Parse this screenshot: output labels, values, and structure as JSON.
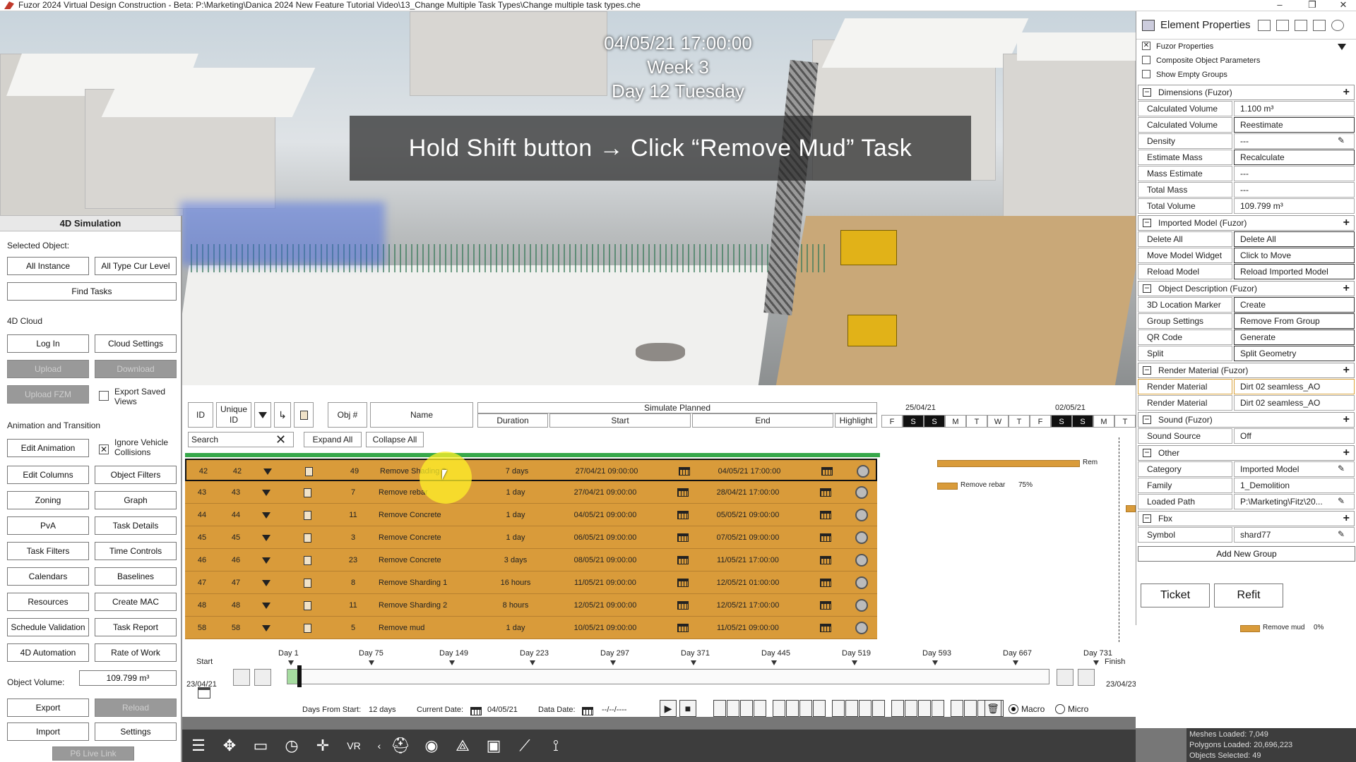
{
  "window": {
    "title": "Fuzor 2024 Virtual Design Construction - Beta: P:\\Marketing\\Danica 2024 New Feature Tutorial Video\\13_Change Multiple Task Types\\Change multiple task types.che",
    "minimize": "–",
    "restore": "❐",
    "close": "✕"
  },
  "viewport": {
    "datetime": "04/05/21 17:00:00",
    "week": "Week 3",
    "day": "Day 12 Tuesday",
    "caption": "Hold Shift button  → Click “Remove Mud” Task"
  },
  "left_panel": {
    "title": "4D Simulation",
    "selected_object_label": "Selected Object:",
    "all_instance": "All Instance",
    "all_type_cur_level": "All Type Cur Level",
    "find_tasks": "Find Tasks",
    "cloud_label": "4D Cloud",
    "log_in": "Log In",
    "cloud_settings": "Cloud Settings",
    "upload": "Upload",
    "download": "Download",
    "upload_fzm": "Upload FZM",
    "export_saved_views": "Export Saved Views",
    "animation_label": "Animation and Transition",
    "edit_animation": "Edit Animation",
    "ignore_vehicle_collisions": "Ignore Vehicle Collisions",
    "ignore_vehicle_checked": "✕",
    "buttons": [
      "Edit Columns",
      "Object Filters",
      "Zoning",
      "Graph",
      "PvA",
      "Task Details",
      "Task Filters",
      "Time Controls",
      "Calendars",
      "Baselines",
      "Resources",
      "Create MAC",
      "Schedule Validation",
      "Task Report",
      "4D Automation",
      "Rate of Work"
    ],
    "object_volume_label": "Object Volume:",
    "object_volume": "109.799 m³",
    "export": "Export",
    "reload": "Reload",
    "import": "Import",
    "settings": "Settings",
    "p6_live_link": "P6 Live Link"
  },
  "table": {
    "headers": {
      "id": "ID",
      "unique_id": "Unique ID",
      "obj": "Obj #",
      "name": "Name",
      "simulate": "Simulate Planned",
      "duration": "Duration",
      "start": "Start",
      "end": "End",
      "highlight": "Highlight"
    },
    "search_placeholder": "Search",
    "search_value": "Search",
    "expand_all": "Expand All",
    "collapse_all": "Collapse All",
    "rows": [
      {
        "id": "42",
        "uid": "42",
        "obj": "49",
        "name": "Remove Shading 3",
        "duration": "7 days",
        "start": "27/04/21 09:00:00",
        "end": "04/05/21 17:00:00"
      },
      {
        "id": "43",
        "uid": "43",
        "obj": "7",
        "name": "Remove rebar",
        "duration": "1 day",
        "start": "27/04/21 09:00:00",
        "end": "28/04/21 17:00:00"
      },
      {
        "id": "44",
        "uid": "44",
        "obj": "11",
        "name": "Remove Concrete",
        "duration": "1 day",
        "start": "04/05/21 09:00:00",
        "end": "05/05/21 09:00:00"
      },
      {
        "id": "45",
        "uid": "45",
        "obj": "3",
        "name": "Remove Concrete",
        "duration": "1 day",
        "start": "06/05/21 09:00:00",
        "end": "07/05/21 09:00:00"
      },
      {
        "id": "46",
        "uid": "46",
        "obj": "23",
        "name": "Remove Concrete",
        "duration": "3 days",
        "start": "08/05/21 09:00:00",
        "end": "11/05/21 17:00:00"
      },
      {
        "id": "47",
        "uid": "47",
        "obj": "8",
        "name": "Remove Sharding 1",
        "duration": "16 hours",
        "start": "11/05/21 09:00:00",
        "end": "12/05/21 01:00:00"
      },
      {
        "id": "48",
        "uid": "48",
        "obj": "11",
        "name": "Remove Sharding 2",
        "duration": "8 hours",
        "start": "12/05/21 09:00:00",
        "end": "12/05/21 17:00:00"
      },
      {
        "id": "58",
        "uid": "58",
        "obj": "5",
        "name": "Remove mud",
        "duration": "1 day",
        "start": "10/05/21 09:00:00",
        "end": "11/05/21 09:00:00"
      }
    ]
  },
  "gantt": {
    "date1": "25/04/21",
    "date2": "02/05/21",
    "days": [
      "F",
      "S",
      "S",
      "M",
      "T",
      "W",
      "T",
      "F",
      "S",
      "S",
      "M",
      "T"
    ],
    "bars": [
      {
        "label": "Rem",
        "progress": "",
        "start": 0.22,
        "end": 0.78
      },
      {
        "label": "Remove rebar",
        "progress": "75%",
        "start": 0.22,
        "end": 0.3
      },
      {
        "label": "",
        "progress": "",
        "start": 0.96,
        "end": 1.0
      },
      {
        "label": "Remove mud",
        "progress": "0%",
        "start": 1.14,
        "end": 1.2
      }
    ]
  },
  "timeline": {
    "start_label": "Start",
    "finish_label": "Finish",
    "start_date": "23/04/21",
    "finish_date": "23/04/23",
    "days": [
      "Day 1",
      "Day 75",
      "Day 149",
      "Day 223",
      "Day 297",
      "Day 371",
      "Day 445",
      "Day 519",
      "Day 593",
      "Day 667",
      "Day 731"
    ]
  },
  "controls": {
    "days_from_start_label": "Days From Start:",
    "days_from_start": "12 days",
    "current_date_label": "Current Date:",
    "current_date": "04/05/21",
    "data_date_label": "Data Date:",
    "data_date": "--/--/----",
    "macro": "Macro",
    "micro": "Micro"
  },
  "stats": {
    "meshes": "Meshes Loaded: 7,049",
    "polygons": "Polygons Loaded: 20,696,223",
    "objects": "Objects Selected: 49"
  },
  "properties": {
    "title": "Element Properties",
    "fuzor_props": "Fuzor Properties",
    "composite": "Composite Object Parameters",
    "show_empty": "Show Empty Groups",
    "checked_mark": "✕",
    "groups": [
      {
        "name": "Dimensions (Fuzor)",
        "props": [
          {
            "k": "Calculated Volume",
            "v": "1.100 m³"
          },
          {
            "k": "Calculated Volume",
            "v": "Reestimate",
            "btn": true
          },
          {
            "k": "Density",
            "v": "---",
            "edit": true
          },
          {
            "k": "Estimate Mass",
            "v": "Recalculate",
            "btn": true
          },
          {
            "k": "Mass Estimate",
            "v": "---"
          },
          {
            "k": "Total Mass",
            "v": "---"
          },
          {
            "k": "Total Volume",
            "v": "109.799 m³"
          }
        ]
      },
      {
        "name": "Imported Model (Fuzor)",
        "props": [
          {
            "k": "Delete All",
            "v": "Delete All",
            "btn": true
          },
          {
            "k": "Move Model Widget",
            "v": "Click to Move",
            "btn": true
          },
          {
            "k": "Reload Model",
            "v": "Reload Imported Model",
            "btn": true
          }
        ]
      },
      {
        "name": "Object Description (Fuzor)",
        "props": [
          {
            "k": "3D Location Marker",
            "v": "Create",
            "btn": true
          },
          {
            "k": "Group Settings",
            "v": "Remove From Group",
            "btn": true
          },
          {
            "k": "QR Code",
            "v": "Generate",
            "btn": true
          },
          {
            "k": "Split",
            "v": "Split Geometry",
            "btn": true
          }
        ]
      },
      {
        "name": "Render Material (Fuzor)",
        "props": [
          {
            "k": "Render Material",
            "v": "Dirt 02 seamless_AO",
            "hl": true
          },
          {
            "k": "Render Material",
            "v": "Dirt 02 seamless_AO"
          }
        ]
      },
      {
        "name": "Sound (Fuzor)",
        "props": [
          {
            "k": "Sound Source",
            "v": "Off"
          }
        ]
      },
      {
        "name": "Other",
        "props": [
          {
            "k": "Category",
            "v": "Imported Model",
            "edit": true
          },
          {
            "k": "Family",
            "v": "1_Demolition"
          },
          {
            "k": "Loaded Path",
            "v": "P:\\Marketing\\Fitz\\20...",
            "edit": true
          }
        ]
      },
      {
        "name": "Fbx",
        "props": [
          {
            "k": "Symbol",
            "v": "shard77",
            "edit": true
          }
        ]
      }
    ],
    "add_new_group": "Add New Group",
    "ticket": "Ticket",
    "refit": "Refit"
  }
}
